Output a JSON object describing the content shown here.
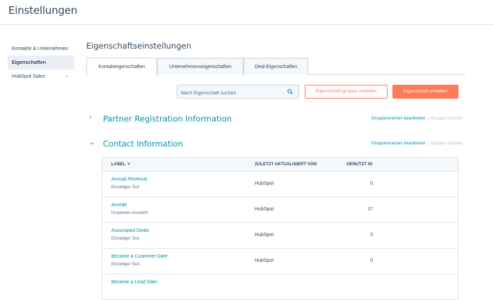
{
  "page": {
    "title": "Einstellungen"
  },
  "sidebar": {
    "items": [
      {
        "label": "Kontakte & Unternehmen"
      },
      {
        "label": "Eigenschaften"
      },
      {
        "label": "HubSpot Sales"
      }
    ]
  },
  "main": {
    "title": "Eigenschaftseinstellungen",
    "tabs": [
      {
        "label": "Kontakteigenschaften",
        "active": true
      },
      {
        "label": "Unternehmenseigenschaften",
        "active": false
      },
      {
        "label": "Deal-Eigenschaften",
        "active": false
      }
    ],
    "search": {
      "placeholder": "Nach Eigenschaft suchen",
      "value": ""
    },
    "buttons": {
      "create_group": "Eigenschaftsgruppe erstellen",
      "create_property": "Eigenschaft erstellen"
    },
    "groups": [
      {
        "name": "Partner Registration Information",
        "expanded": false,
        "edit_label": "Gruppennamen bearbeiten",
        "delete_label": "Gruppe löschen"
      },
      {
        "name": "Contact Information",
        "expanded": true,
        "edit_label": "Gruppennamen bearbeiten",
        "delete_label": "Gruppe löschen"
      }
    ],
    "table": {
      "headers": {
        "label": "LABEL",
        "updated_by": "ZULETZT AKTUALISIERT VON",
        "used_in": "GENUTZT IN"
      },
      "sorted_by": "label",
      "rows": [
        {
          "name": "Annual Revenue",
          "type": "Einzeiliger Text",
          "updated_by": "HubSpot",
          "used_in": "0"
        },
        {
          "name": "Anrede",
          "type": "Dropdown-Auswahl",
          "updated_by": "HubSpot",
          "used_in": "37"
        },
        {
          "name": "Associated Deals",
          "type": "Einzeiliger Text",
          "updated_by": "HubSpot",
          "used_in": "0"
        },
        {
          "name": "Became a Customer Date",
          "type": "Einzeiliger Text",
          "updated_by": "HubSpot",
          "used_in": "0"
        },
        {
          "name": "Became a Lead Date",
          "type": "",
          "updated_by": "",
          "used_in": ""
        }
      ]
    }
  },
  "colors": {
    "accent": "#0091ae",
    "primary_button": "#ff7a59",
    "text": "#33475b",
    "active_sidebar_bg": "#eaf0f6"
  },
  "icons": {
    "search": "search-icon",
    "expand": "chevron-down-icon",
    "collapse": "chevron-right-icon",
    "sort": "sort-down-icon"
  }
}
